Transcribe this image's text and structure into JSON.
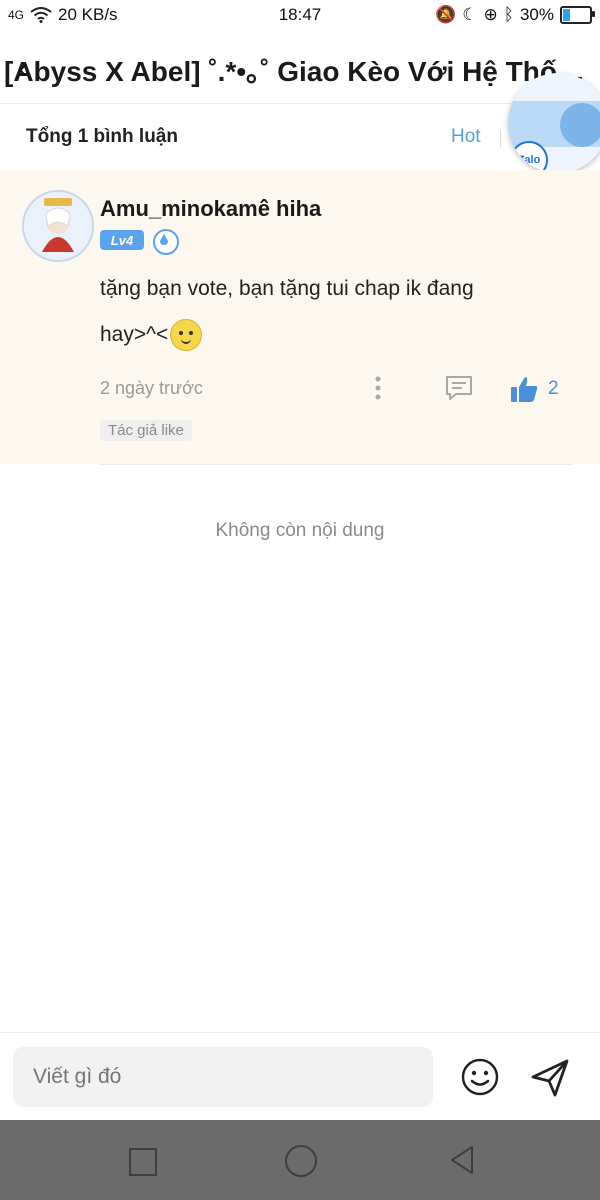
{
  "status_bar": {
    "network": "4G",
    "speed": "20 KB/s",
    "time": "18:47",
    "battery": "30%",
    "battery_level": 0.3
  },
  "header": {
    "title": "[Abyss X Abel] ˚.*•｡˚ Giao Kèo Với Hệ Thống..."
  },
  "comments_header": {
    "total_label": "Tổng 1 bình luận",
    "sort_label": "Hot"
  },
  "zalo": {
    "label": "Zalo"
  },
  "comment": {
    "username": "Amu_minokamê hiha",
    "level": "Lv4",
    "text": "tặng bạn vote, bạn tặng tui chap ik đang hay>^<",
    "time_ago": "2 ngày trước",
    "like_count": "2",
    "author_like": "Tác giả like"
  },
  "footer_text": "Không còn nội dung",
  "input": {
    "placeholder": "Viết gì đó"
  },
  "colors": {
    "accent": "#4a90d9",
    "card_bg": "#fcf8ef"
  }
}
